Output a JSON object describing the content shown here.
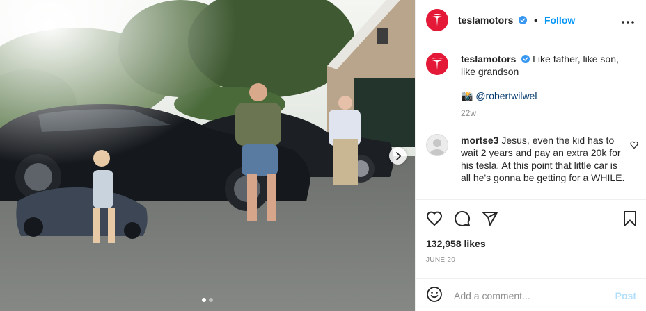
{
  "post": {
    "image_alt": "Father, son and grandson with black Tesla cars and a toy Tesla",
    "carousel": {
      "count": 2,
      "active": 0
    }
  },
  "header": {
    "username": "teslamotors",
    "separator": "•",
    "follow_label": "Follow",
    "avatar_icon": "tesla-logo-icon",
    "brand_color": "#e31937"
  },
  "caption": {
    "username": "teslamotors",
    "text": "Like father, like son, like grandson",
    "credit_emoji": "📸",
    "credit_mention": "@robertwilwel",
    "age": "22w"
  },
  "comment": {
    "username": "mortse3",
    "text": "Jesus, even the kid has to wait 2 years and pay an extra 20k for his tesla. At this point that little car is all he's gonna be getting for a WHILE."
  },
  "actions": {
    "likes": "132,958 likes",
    "date": "JUNE 20"
  },
  "composer": {
    "placeholder": "Add a comment...",
    "post_label": "Post"
  },
  "colors": {
    "link": "#0095f6",
    "muted": "#8e8e8e",
    "border": "#efefef"
  }
}
